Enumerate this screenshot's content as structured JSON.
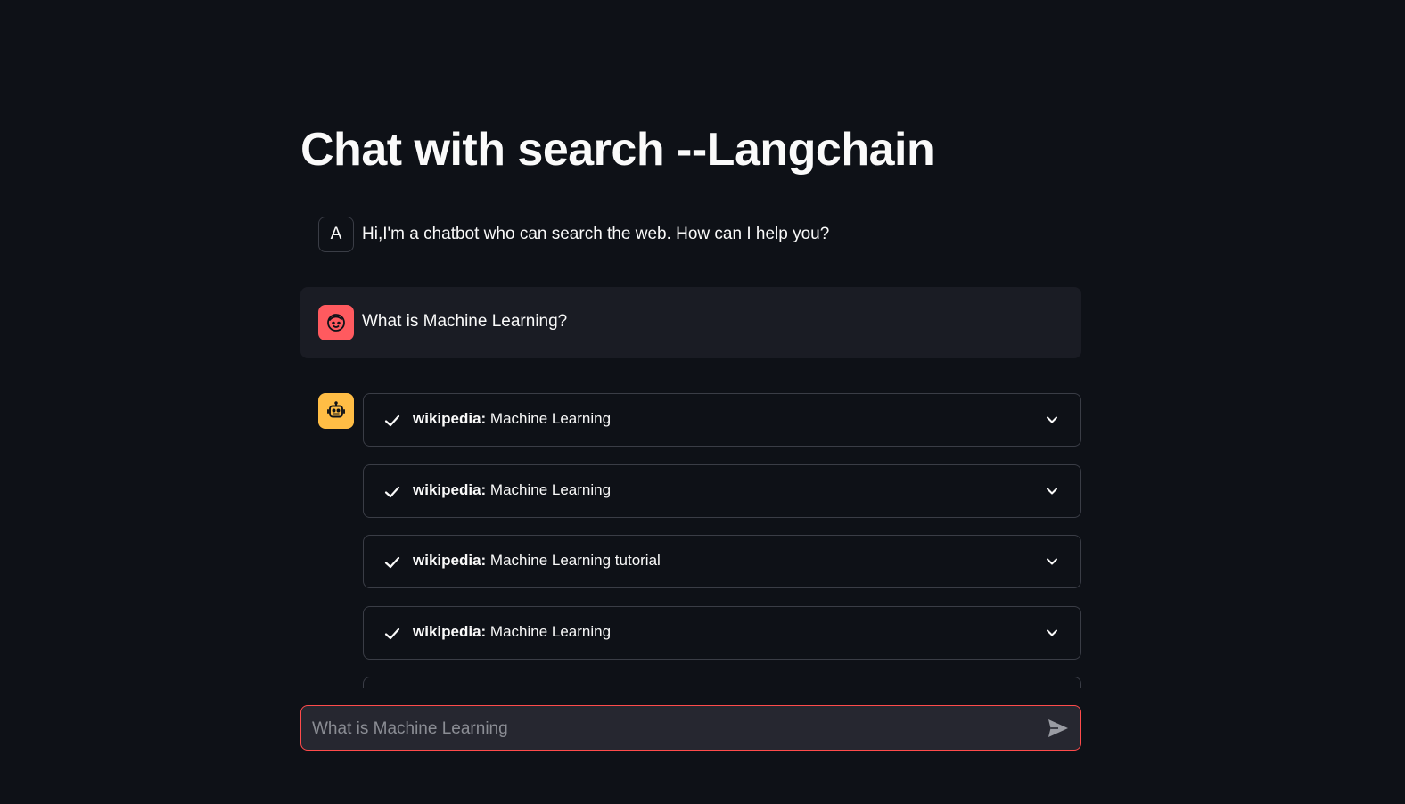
{
  "page": {
    "title": "Chat with search --Langchain"
  },
  "messages": {
    "assistant_intro": {
      "avatar_letter": "A",
      "text": "Hi,I'm a chatbot who can search the web. How can I help you?"
    },
    "user_question": {
      "avatar_icon": "face-icon",
      "text": "What is Machine Learning?"
    },
    "bot_response": {
      "avatar_icon": "robot-icon",
      "steps": [
        {
          "tool": "wikipedia:",
          "query": "Machine Learning",
          "status_icon": "check-icon",
          "toggle_icon": "chevron-down-icon"
        },
        {
          "tool": "wikipedia:",
          "query": "Machine Learning",
          "status_icon": "check-icon",
          "toggle_icon": "chevron-down-icon"
        },
        {
          "tool": "wikipedia:",
          "query": "Machine Learning tutorial",
          "status_icon": "check-icon",
          "toggle_icon": "chevron-down-icon"
        },
        {
          "tool": "wikipedia:",
          "query": "Machine Learning",
          "status_icon": "check-icon",
          "toggle_icon": "chevron-down-icon"
        },
        {
          "tool": "",
          "query": "",
          "status_icon": "",
          "toggle_icon": ""
        }
      ]
    }
  },
  "chat_input": {
    "placeholder": "What is Machine Learning",
    "value": "",
    "send_icon": "send-icon"
  },
  "colors": {
    "background": "#0e1117",
    "user_message_bg": "#1a1c24",
    "user_avatar": "#ff5a5f",
    "bot_avatar": "#ffbd45",
    "input_border_focus": "#ff4b4b",
    "input_bg": "#262730",
    "border": "#3a3d46"
  }
}
